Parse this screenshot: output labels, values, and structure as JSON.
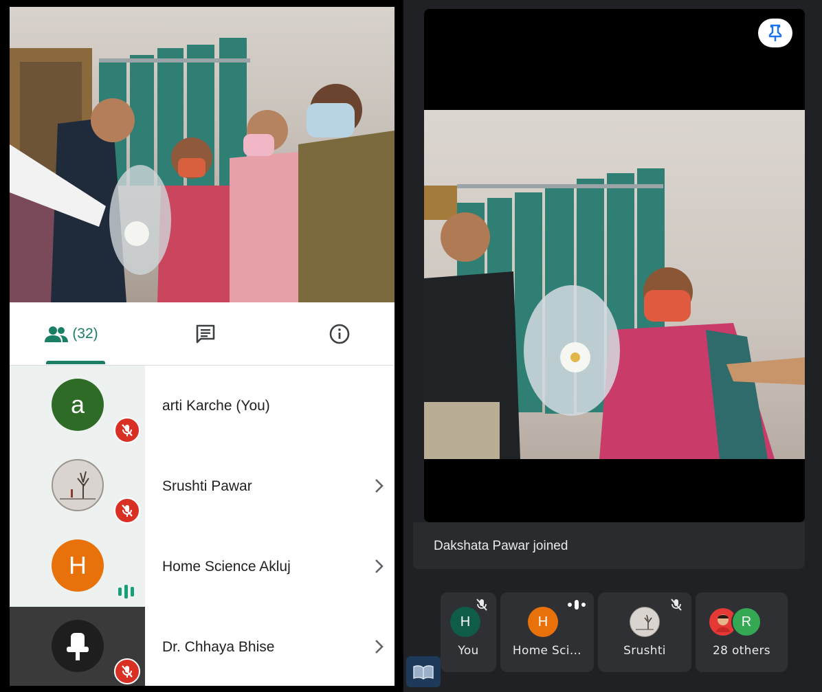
{
  "tabs": {
    "people_count": "(32)",
    "people_icon": "people-icon",
    "chat_icon": "chat-icon",
    "info_icon": "info-icon"
  },
  "participants": [
    {
      "name": "arti Karche (You)",
      "avatar_letter": "a",
      "avatar_color": "#2e6b26",
      "status": "muted",
      "chevron": false
    },
    {
      "name": "Srushti Pawar",
      "avatar_letter": "",
      "avatar_color": "#d9d4cf",
      "status": "muted",
      "chevron": true
    },
    {
      "name": "Home Science Akluj",
      "avatar_letter": "H",
      "avatar_color": "#e8710a",
      "status": "speaking",
      "chevron": true
    },
    {
      "name": "Dr. Chhaya Bhise",
      "avatar_letter": "",
      "avatar_color": "#2b2b2b",
      "status": "muted",
      "chevron": true
    }
  ],
  "notification": {
    "text": "Dakshata Pawar joined"
  },
  "strip": [
    {
      "label": "You",
      "avatar_letter": "H",
      "avatar_color": "#0f5c49",
      "status": "muted"
    },
    {
      "label": "Home Sci…",
      "avatar_letter": "H",
      "avatar_color": "#e8710a",
      "status": "speaking"
    },
    {
      "label": "Srushti",
      "avatar_letter": "",
      "avatar_color": "#d9d4cf",
      "status": "muted"
    },
    {
      "label": "28 others",
      "avatar_letter": "R",
      "avatar_color": "#34a853",
      "status": "none"
    }
  ],
  "colors": {
    "accent": "#1a7f64",
    "mute": "#d93025",
    "surface_dark": "#202124"
  }
}
